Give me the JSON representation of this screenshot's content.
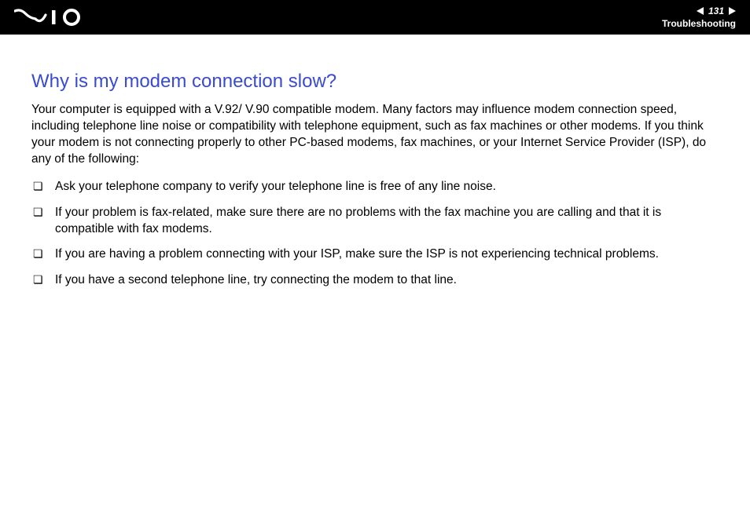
{
  "header": {
    "page_number": "131",
    "breadcrumb": "Troubleshooting"
  },
  "page": {
    "title": "Why is my modem connection slow?",
    "intro": "Your computer is equipped with a V.92/ V.90 compatible modem. Many factors may influence modem connection speed, including telephone line noise or compatibility with telephone equipment, such as fax machines or other modems. If you think your modem is not connecting properly to other PC-based modems, fax machines, or your Internet Service Provider (ISP), do any of the following:",
    "bullets": [
      "Ask your telephone company to verify your telephone line is free of any line noise.",
      "If your problem is fax-related, make sure there are no problems with the fax machine you are calling and that it is compatible with fax modems.",
      "If you are having a problem connecting with your ISP, make sure the ISP is not experiencing technical problems.",
      "If you have a second telephone line, try connecting the modem to that line."
    ]
  }
}
